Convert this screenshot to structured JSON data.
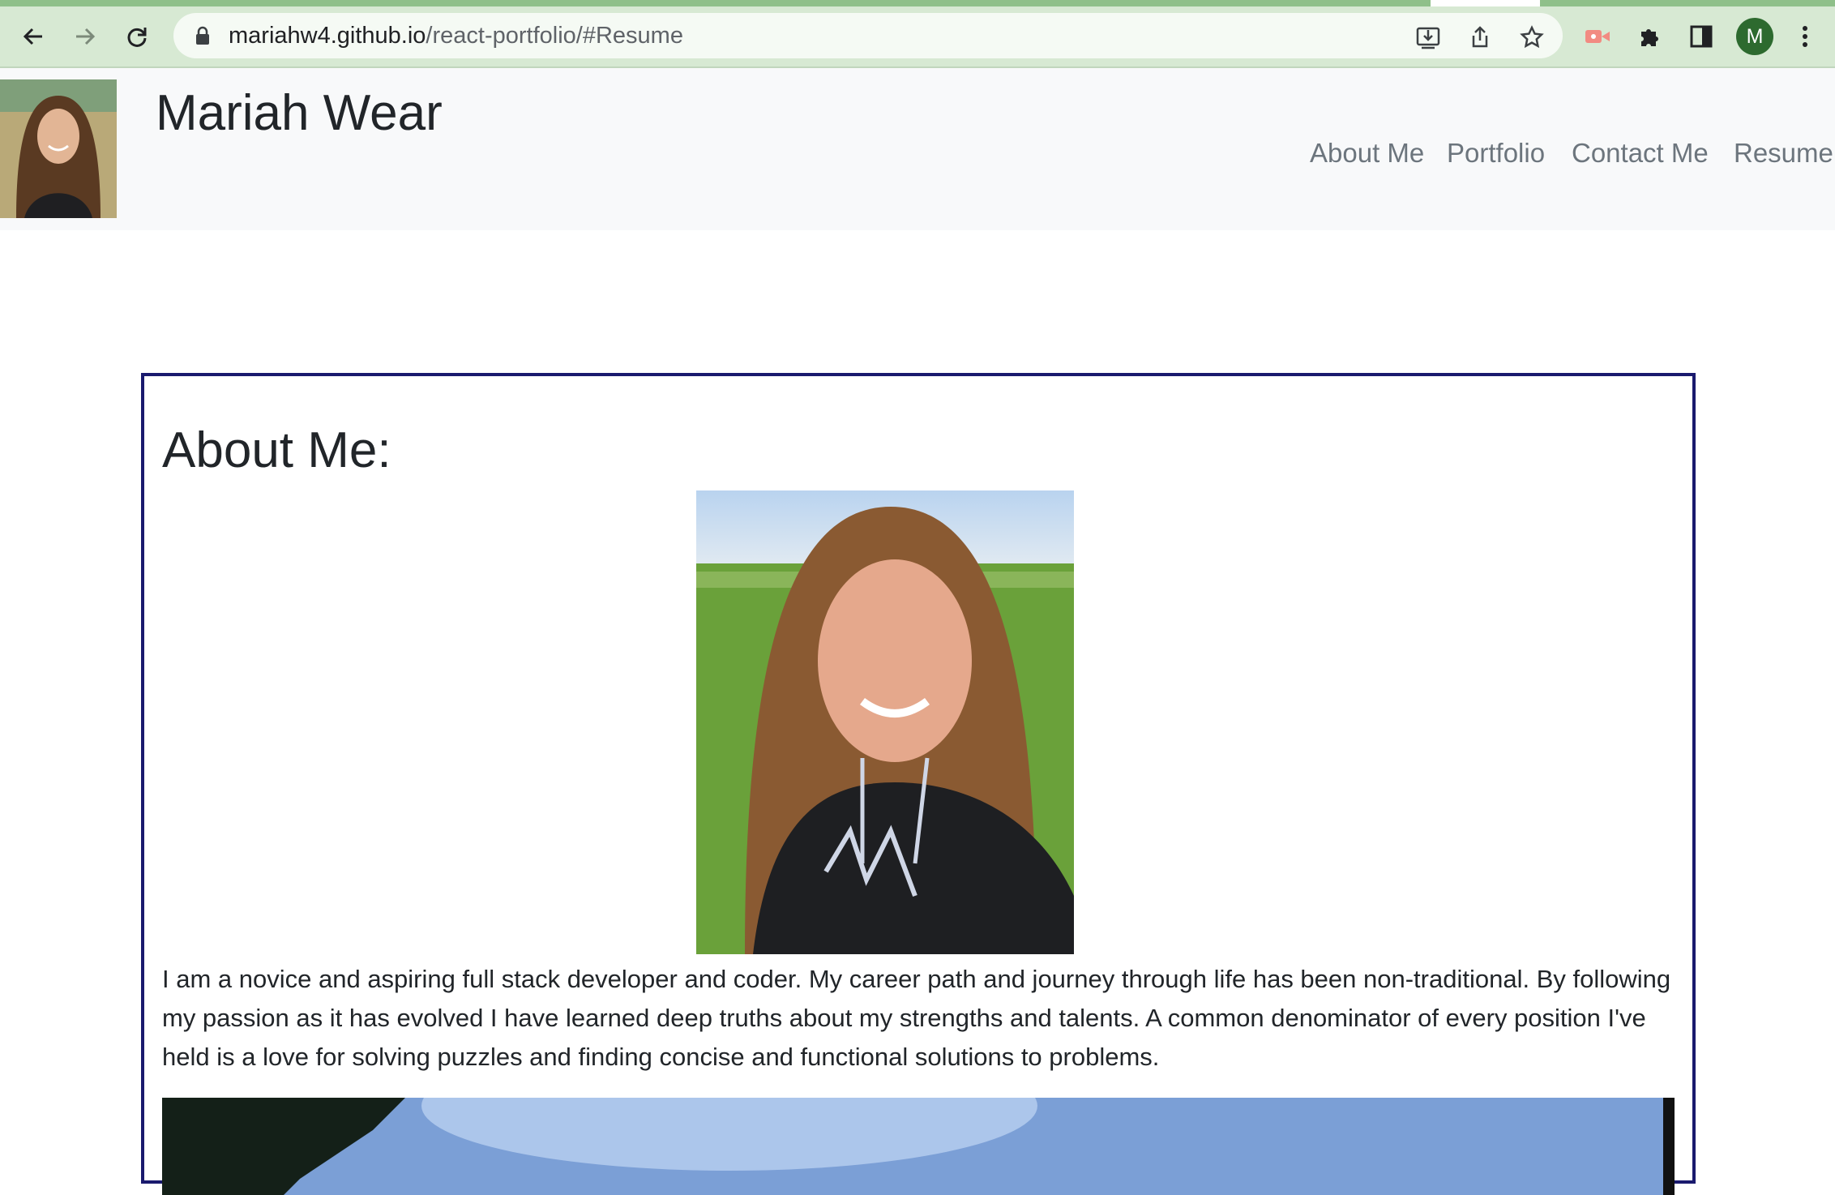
{
  "browser": {
    "url_host": "mariahw4.github.io",
    "url_path": "/react-portfolio/#Resume",
    "profile_initial": "M",
    "icons": [
      "back-icon",
      "forward-icon",
      "reload-icon",
      "lock-icon",
      "install-icon",
      "share-icon",
      "star-icon",
      "extension-pin-icon",
      "puzzle-icon",
      "sidebar-icon",
      "menu-icon"
    ],
    "colors": {
      "toolbar": "#d7e9d3",
      "profile": "#2d6a2f"
    }
  },
  "header": {
    "title": "Mariah Wear",
    "nav": [
      "About Me",
      "Portfolio",
      "Contact Me",
      "Resume"
    ]
  },
  "main": {
    "heading": "About Me:",
    "paragraph": "I am a novice and aspiring full stack developer and coder. My career path and journey through life has been non-traditional. By following my passion as it has evolved I have learned deep truths about my strengths and talents. A common denominator of every position I've held is a love for solving puzzles and finding concise and functional solutions to problems.",
    "card_border_color": "#1a1a6e"
  }
}
